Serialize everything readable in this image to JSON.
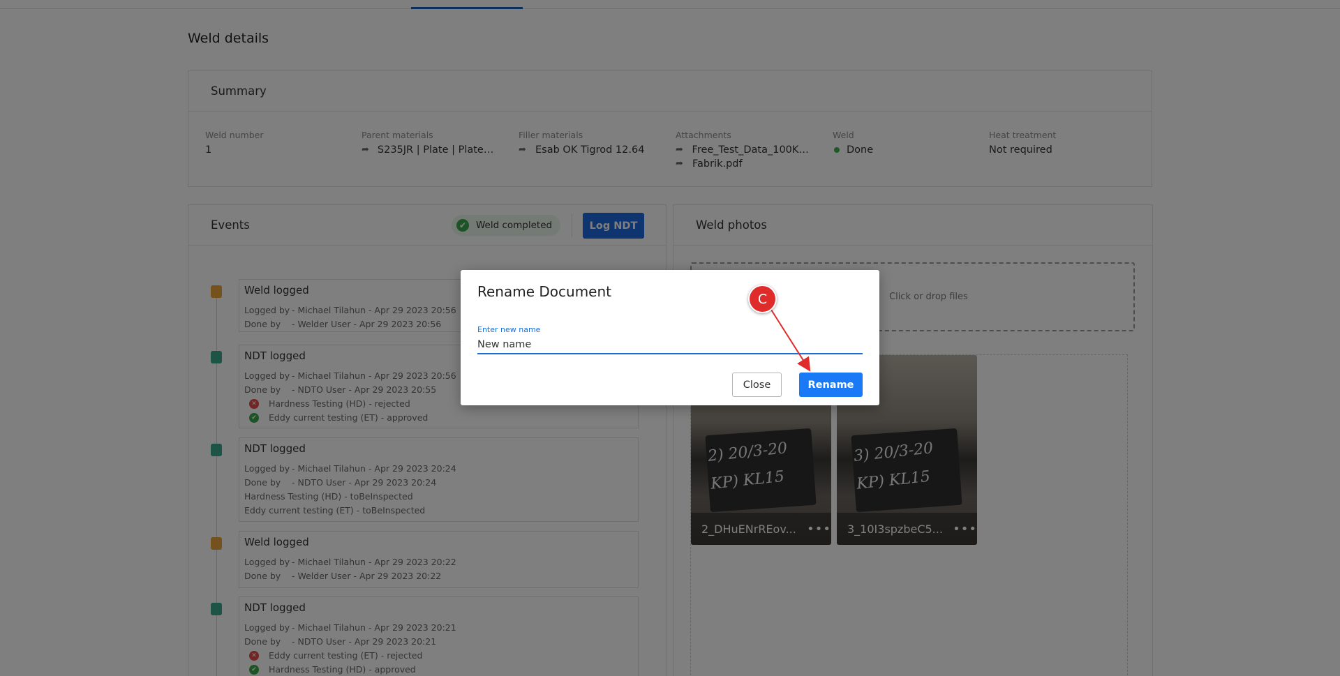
{
  "page": {
    "title": "Weld details"
  },
  "summary": {
    "header": "Summary",
    "weld_number": {
      "label": "Weld number",
      "value": "1"
    },
    "parent_materials": {
      "label": "Parent materials",
      "value": "S235JR | Plate | Plate 4..."
    },
    "filler_materials": {
      "label": "Filler materials",
      "value": "Esab OK Tigrod 12.64"
    },
    "attachments": {
      "label": "Attachments",
      "items": [
        "Free_Test_Data_100KB...",
        "Fabrik.pdf"
      ]
    },
    "weld": {
      "label": "Weld",
      "value": "Done",
      "status_color": "#3ab14a"
    },
    "heat_treatment": {
      "label": "Heat treatment",
      "value": "Not required"
    }
  },
  "events": {
    "header": "Events",
    "badge": "Weld completed",
    "log_ndt": "Log NDT",
    "items": [
      {
        "title": "Weld logged",
        "icon": "weld-icon",
        "logged_by_label": "Logged by",
        "logged_by": "- Michael Tilahun - Apr 29 2023 20:56",
        "done_by_label": "Done by",
        "done_by": "- Welder User - Apr 29 2023 20:56"
      },
      {
        "title": "NDT logged",
        "icon": "clipboard-check-icon",
        "logged_by_label": "Logged by",
        "logged_by": "- Michael Tilahun - Apr 29 2023 20:56",
        "done_by_label": "Done by",
        "done_by": "- NDTO User - Apr 29 2023 20:55",
        "results": [
          "Hardness Testing (HD) - rejected",
          "Eddy current testing (ET) - approved"
        ]
      },
      {
        "title": "NDT logged",
        "icon": "clipboard-check-icon",
        "logged_by_label": "Logged by",
        "logged_by": "- Michael Tilahun - Apr 29 2023 20:24",
        "done_by_label": "Done by",
        "done_by": "- NDTO User - Apr 29 2023 20:24",
        "results": [
          "Hardness Testing (HD) - toBeInspected",
          "Eddy current testing (ET) - toBeInspected"
        ]
      },
      {
        "title": "Weld logged",
        "icon": "weld-icon",
        "logged_by_label": "Logged by",
        "logged_by": "- Michael Tilahun - Apr 29 2023 20:22",
        "done_by_label": "Done by",
        "done_by": "- Welder User - Apr 29 2023 20:22"
      },
      {
        "title": "NDT logged",
        "icon": "clipboard-check-icon",
        "logged_by_label": "Logged by",
        "logged_by": "- Michael Tilahun - Apr 29 2023 20:21",
        "done_by_label": "Done by",
        "done_by": "- NDTO User - Apr 29 2023 20:21",
        "results": [
          "Eddy current testing (ET) - rejected",
          "Hardness Testing (HD) - approved"
        ]
      }
    ]
  },
  "photos": {
    "header": "Weld photos",
    "dropzone_text": "Click or drop files",
    "items": [
      {
        "caption": "2_DHuENrREov...",
        "chalk_line1": "2) 20/3-20",
        "chalk_line2": "KP) KL15"
      },
      {
        "caption": "3_10I3spzbeC5...",
        "chalk_line1": "3) 20/3-20",
        "chalk_line2": "KP) KL15"
      }
    ],
    "more_glyph": "•••"
  },
  "modal": {
    "title": "Rename Document",
    "field_label": "Enter new name",
    "field_value": "New name",
    "close": "Close",
    "rename": "Rename"
  },
  "annotation": {
    "marker": "C",
    "color": "#e02b2b"
  }
}
